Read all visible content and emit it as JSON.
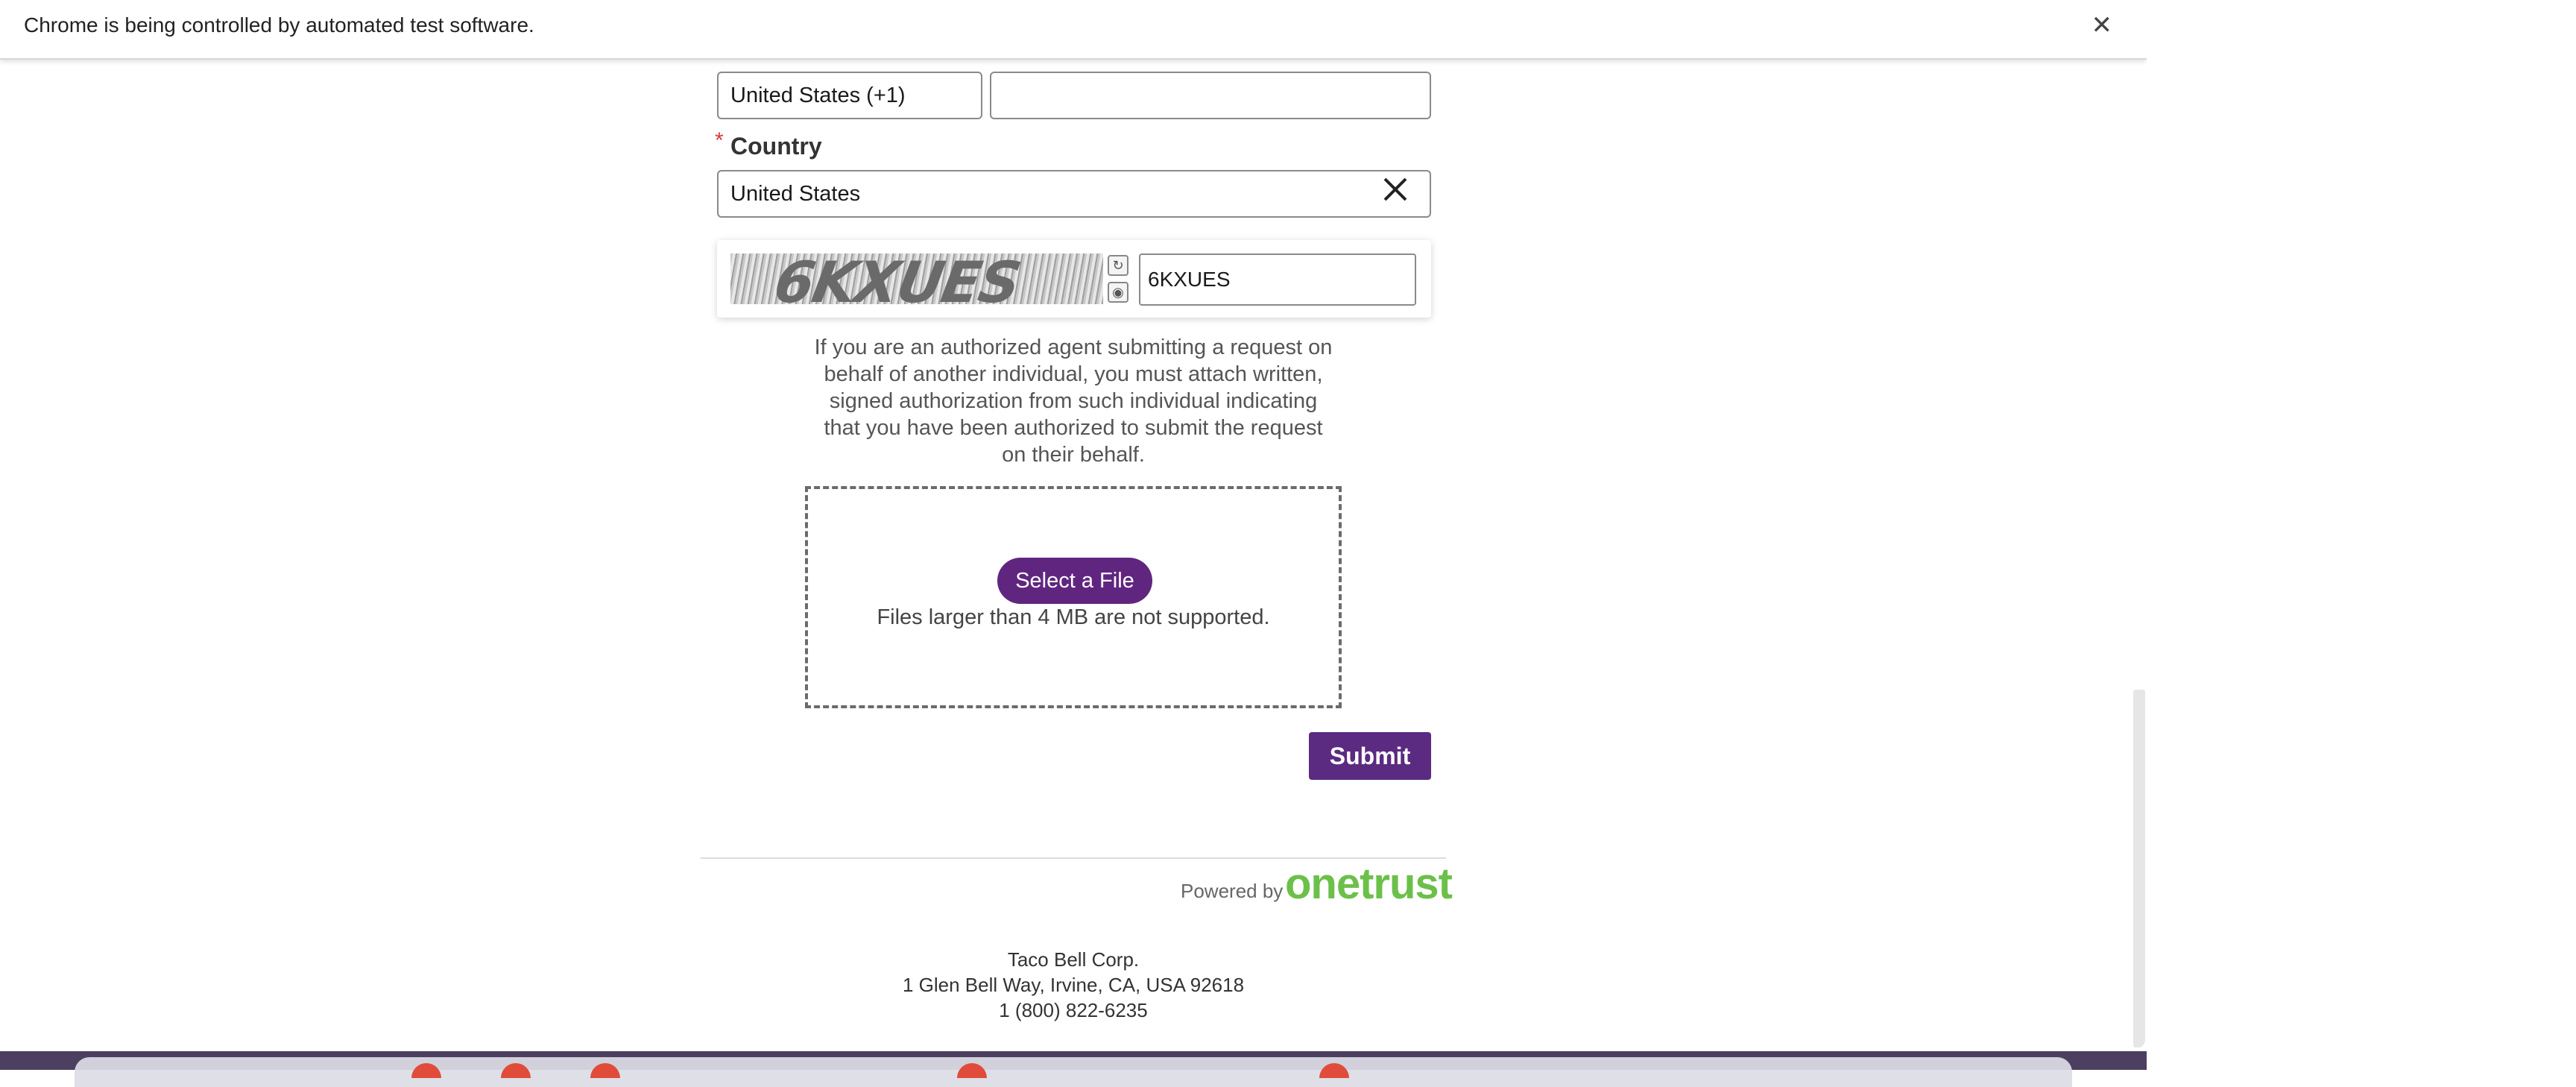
{
  "infobar": {
    "message": "Chrome is being controlled by automated test software.",
    "close_icon": "close-icon"
  },
  "form": {
    "phone_country_value": "United States (+1)",
    "phone_number_value": "",
    "country_label": "Country",
    "required_marker": "*",
    "country_value": "United States",
    "clear_icon": "close-icon"
  },
  "captcha": {
    "image_text": "6KXUES",
    "input_value": "6KXUES",
    "refresh_icon": "refresh-icon",
    "audio_icon": "audio-icon"
  },
  "notice": {
    "text": "If you are an authorized agent submitting a request on behalf of another individual, you must attach written, signed authorization from such individual indicating that you have been authorized to submit the request on their behalf."
  },
  "upload": {
    "select_label": "Select a File",
    "note": "Files larger than 4 MB are not supported."
  },
  "submit_label": "Submit",
  "footer": {
    "powered_by": "Powered by",
    "brand": "onetrust",
    "company": "Taco Bell Corp.",
    "address": "1 Glen Bell Way, Irvine, CA, USA 92618",
    "phone": "1 (800) 822-6235"
  },
  "colors": {
    "accent": "#5b2a81",
    "brand_green": "#6cc04a",
    "required": "#d83b3b"
  }
}
